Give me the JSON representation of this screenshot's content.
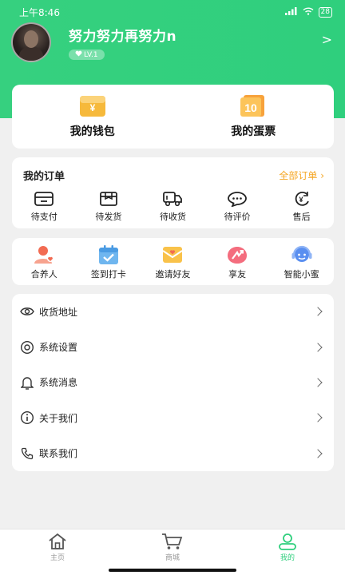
{
  "status_bar": {
    "time": "上午8:46",
    "signal": "4G",
    "battery": "28"
  },
  "profile": {
    "username": "努力努力再努力n",
    "level": "LV.1"
  },
  "wallet": {
    "items": [
      {
        "label": "我的钱包",
        "icon": "wallet-icon"
      },
      {
        "label": "我的蛋票",
        "icon": "ticket-icon"
      }
    ]
  },
  "orders": {
    "title": "我的订单",
    "all_label": "全部订单",
    "items": [
      {
        "label": "待支付",
        "icon": "card-icon"
      },
      {
        "label": "待发货",
        "icon": "box-icon"
      },
      {
        "label": "待收货",
        "icon": "truck-icon"
      },
      {
        "label": "待评价",
        "icon": "comment-icon"
      },
      {
        "label": "售后",
        "icon": "refund-icon"
      }
    ]
  },
  "tools": {
    "items": [
      {
        "label": "合养人",
        "icon": "partner-icon"
      },
      {
        "label": "签到打卡",
        "icon": "calendar-check-icon"
      },
      {
        "label": "邀请好友",
        "icon": "invite-icon"
      },
      {
        "label": "享友",
        "icon": "share-icon"
      },
      {
        "label": "智能小蜜",
        "icon": "assistant-icon"
      }
    ]
  },
  "menu": {
    "items": [
      {
        "label": "收货地址",
        "icon": "eye-icon"
      },
      {
        "label": "系统设置",
        "icon": "settings-icon"
      },
      {
        "label": "系统消息",
        "icon": "bell-icon"
      },
      {
        "label": "关于我们",
        "icon": "info-icon"
      },
      {
        "label": "联系我们",
        "icon": "phone-icon"
      }
    ]
  },
  "tabbar": {
    "items": [
      {
        "label": "主页",
        "icon": "home-icon",
        "active": false
      },
      {
        "label": "商城",
        "icon": "cart-icon",
        "active": false
      },
      {
        "label": "我的",
        "icon": "user-icon",
        "active": true
      }
    ]
  },
  "colors": {
    "brand_green": "#2fcf7d",
    "accent_orange": "#f5a623"
  }
}
